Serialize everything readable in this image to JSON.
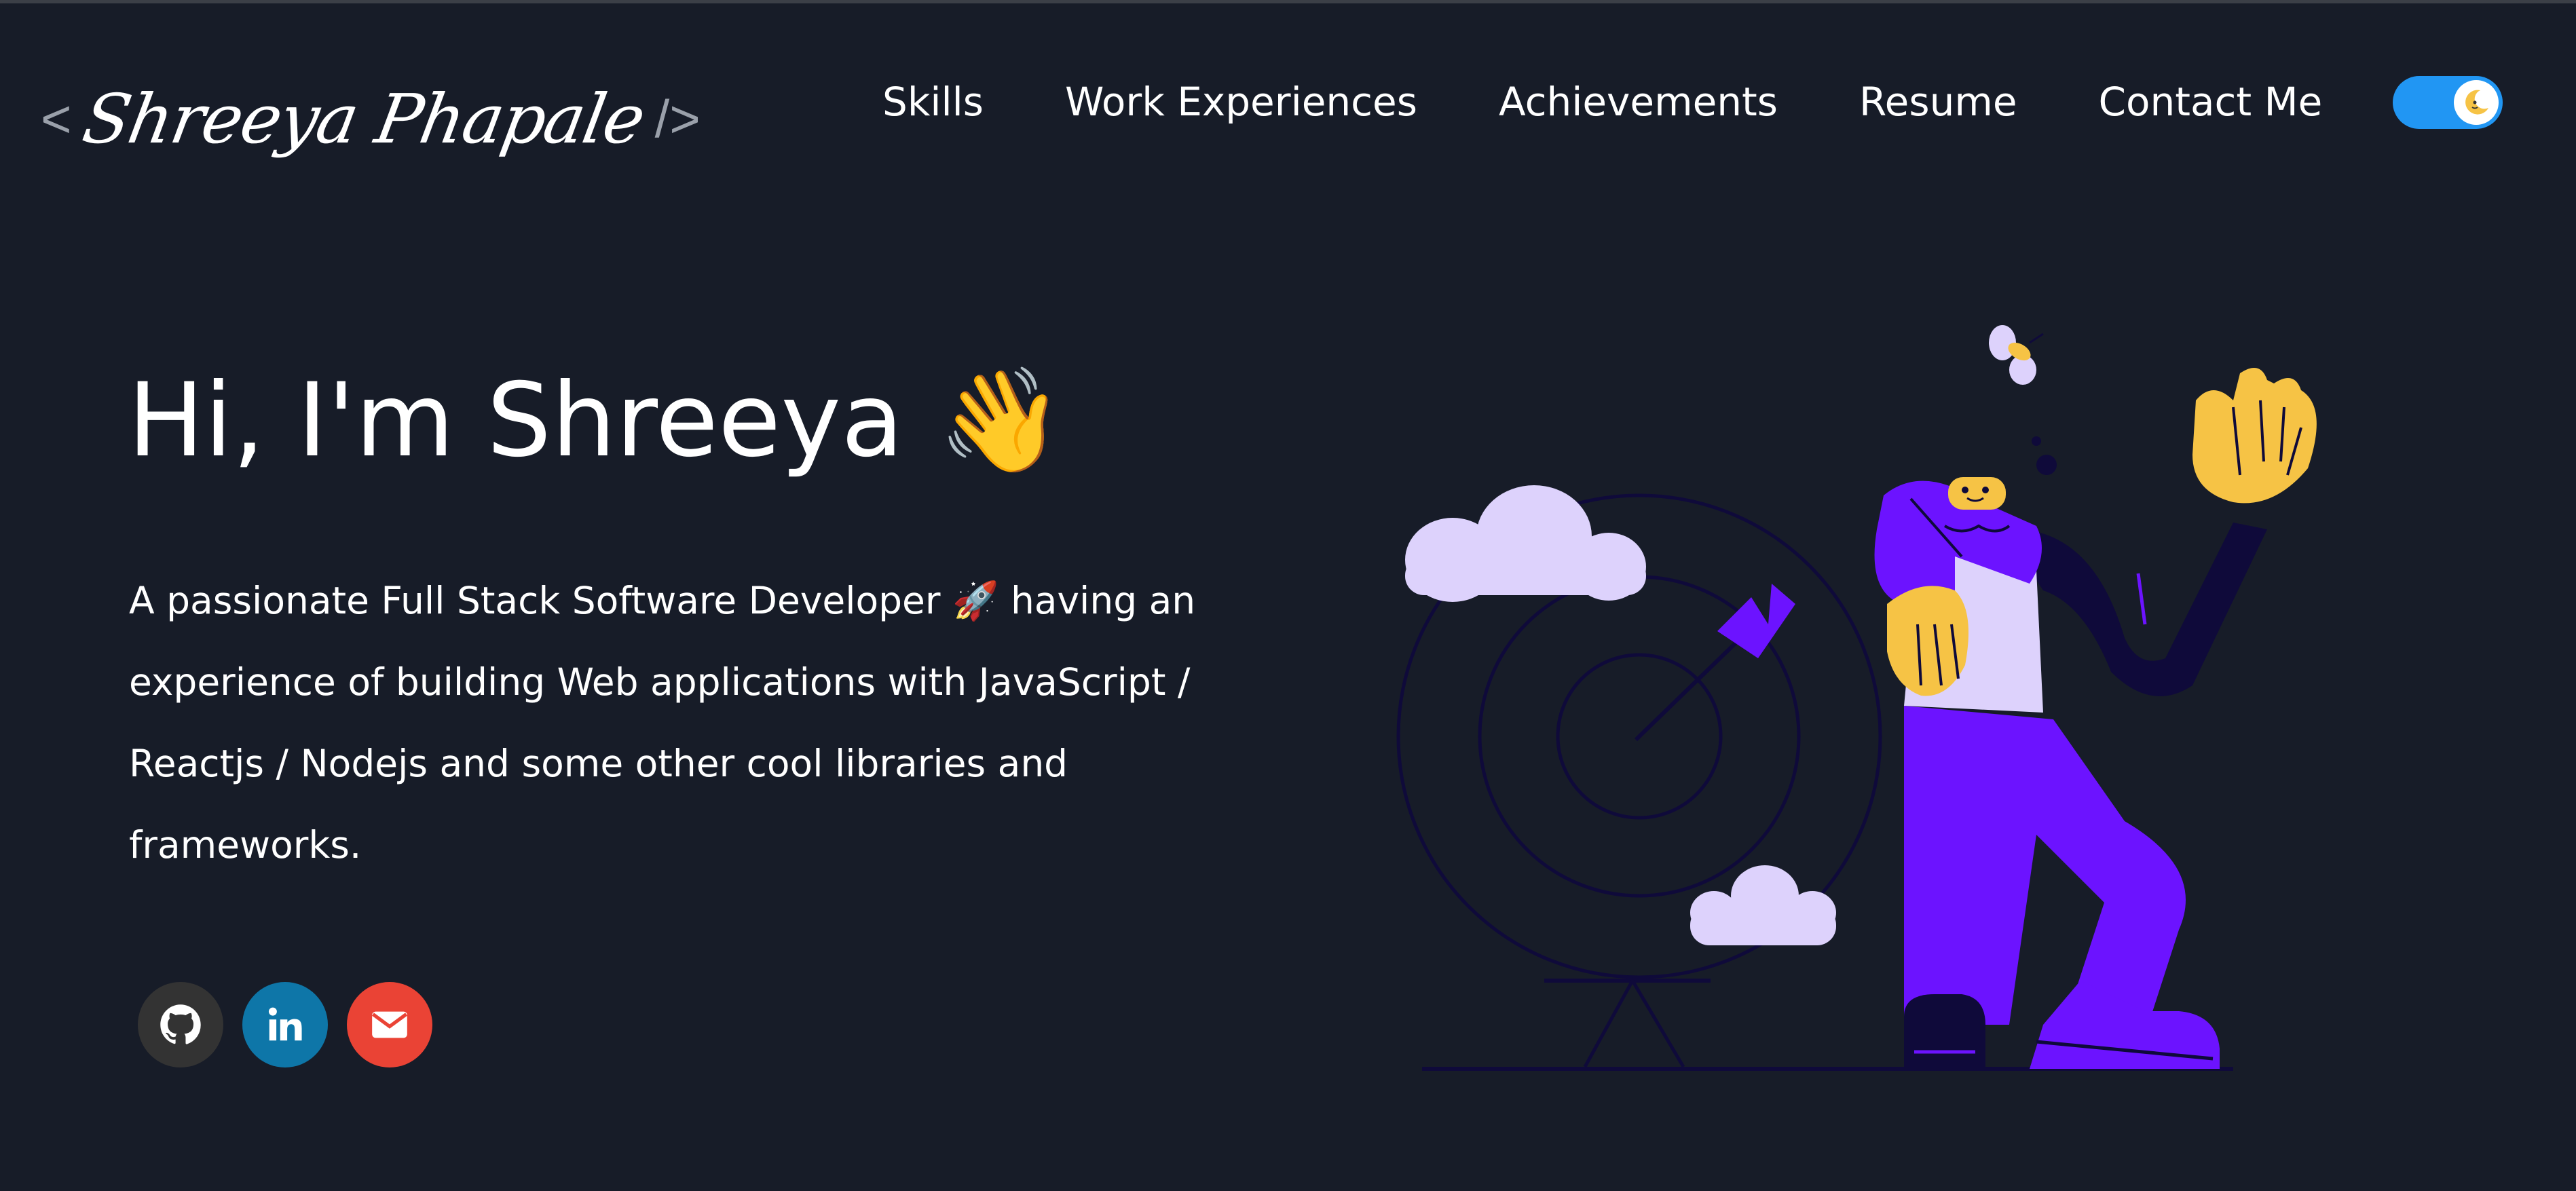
{
  "header": {
    "logo_open": "<",
    "logo_name": "Shreeya Phapale",
    "logo_close": "/>",
    "nav": [
      "Skills",
      "Work Experiences",
      "Achievements",
      "Resume",
      "Contact Me"
    ],
    "theme_toggle": {
      "state": "on",
      "icon": "moon-icon",
      "color": "#2196f3"
    }
  },
  "hero": {
    "greeting": "Hi, I'm Shreeya",
    "greeting_emoji": "👋",
    "description": "A passionate Full Stack Software Developer 🚀 having an experience of building Web applications with JavaScript / Reactjs / Nodejs and some other cool libraries and frameworks.",
    "socials": [
      {
        "name": "github-icon",
        "color": "#333333"
      },
      {
        "name": "linkedin-icon",
        "color": "#0e76a8"
      },
      {
        "name": "email-icon",
        "color": "#ea4335"
      }
    ]
  },
  "colors": {
    "background": "#171c28",
    "accent": "#6c13ff",
    "skin": "#f6c345",
    "cloud": "#ddd2fc"
  }
}
